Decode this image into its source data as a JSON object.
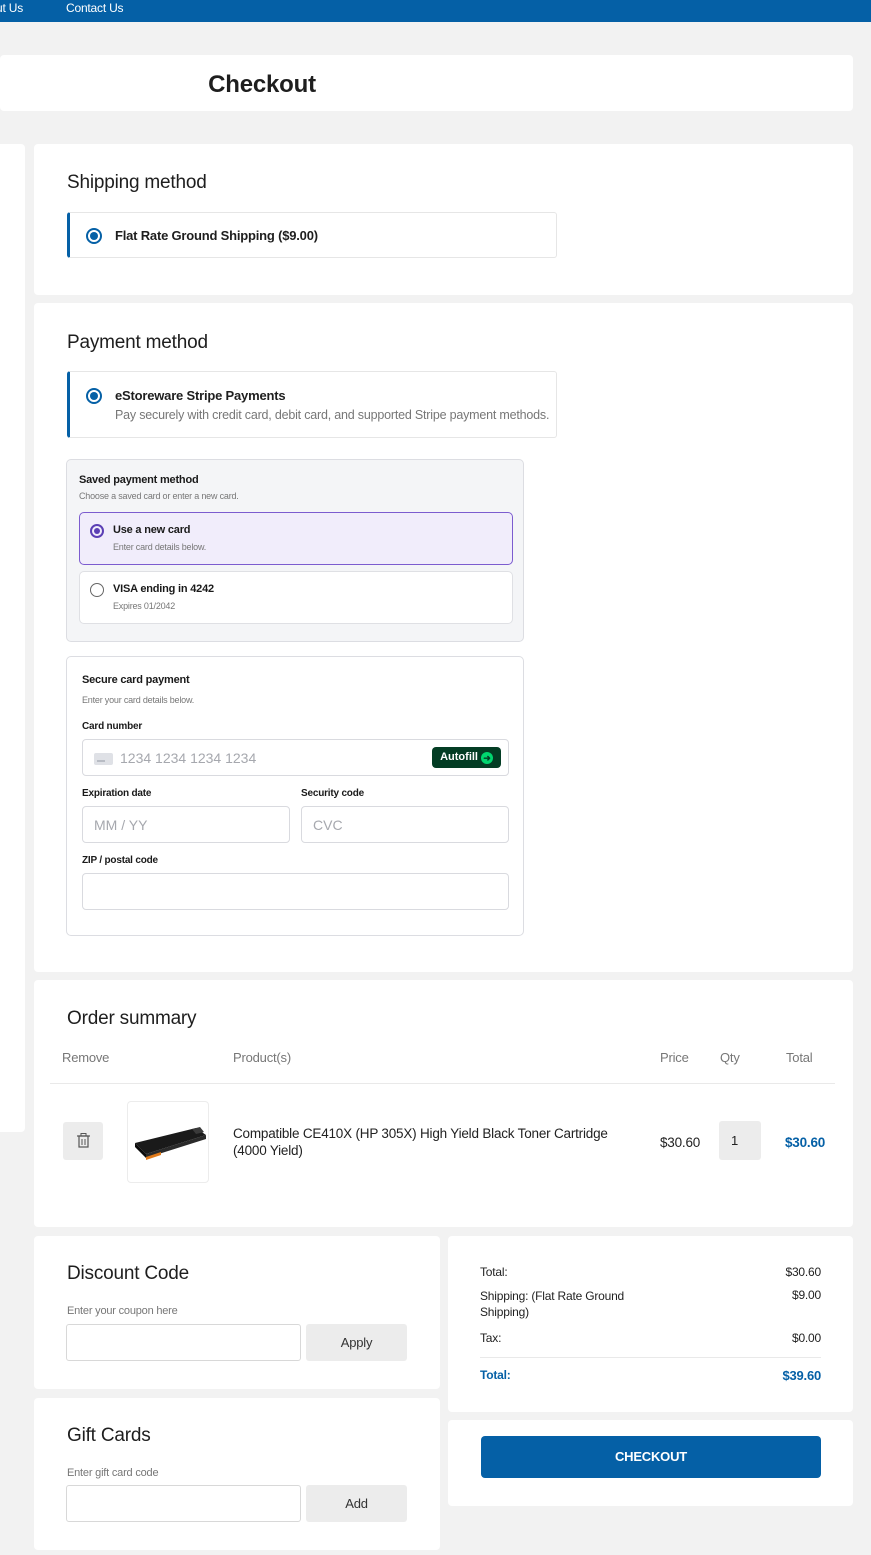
{
  "nav": {
    "about": "ut Us",
    "contact": "Contact Us"
  },
  "page": {
    "title": "Checkout"
  },
  "shipping": {
    "title": "Shipping method",
    "option_label": "Flat Rate Ground Shipping ($9.00)"
  },
  "payment": {
    "title": "Payment method",
    "option_label": "eStoreware Stripe Payments",
    "option_desc": "Pay securely with credit card, debit card, and supported Stripe payment methods.",
    "saved": {
      "title": "Saved payment method",
      "subtitle": "Choose a saved card or enter a new card.",
      "new_card_label": "Use a new card",
      "new_card_desc": "Enter card details below.",
      "visa_label": "VISA ending in 4242",
      "visa_desc": "Expires 01/2042"
    },
    "secure": {
      "title": "Secure card payment",
      "subtitle": "Enter your card details below.",
      "card_number_label": "Card number",
      "card_number_placeholder": "1234 1234 1234 1234",
      "autofill_label": "Autofill",
      "autofill_icon": "arrow-circle-icon",
      "expiry_label": "Expiration date",
      "expiry_placeholder": "MM / YY",
      "cvc_label": "Security code",
      "cvc_placeholder": "CVC",
      "zip_label": "ZIP / postal code"
    }
  },
  "order": {
    "title": "Order summary",
    "headers": {
      "remove": "Remove",
      "product": "Product(s)",
      "price": "Price",
      "qty": "Qty",
      "total": "Total"
    },
    "items": [
      {
        "name": "Compatible CE410X (HP 305X) High Yield Black Toner Cartridge (4000 Yield)",
        "price": "$30.60",
        "qty": "1",
        "total": "$30.60"
      }
    ]
  },
  "discount": {
    "title": "Discount Code",
    "label": "Enter your coupon here",
    "button": "Apply"
  },
  "gift": {
    "title": "Gift Cards",
    "label": "Enter gift card code",
    "button": "Add"
  },
  "totals": {
    "subtotal_label": "Total:",
    "subtotal_value": "$30.60",
    "shipping_label": "Shipping: (Flat Rate Ground Shipping)",
    "shipping_value": "$9.00",
    "tax_label": "Tax:",
    "tax_value": "$0.00",
    "total_label": "Total:",
    "total_value": "$39.60"
  },
  "checkout_button": "CHECKOUT",
  "colors": {
    "brand": "#0560a6",
    "stripe_accent": "#5b3fb5",
    "autofill_bg": "#033d24"
  }
}
